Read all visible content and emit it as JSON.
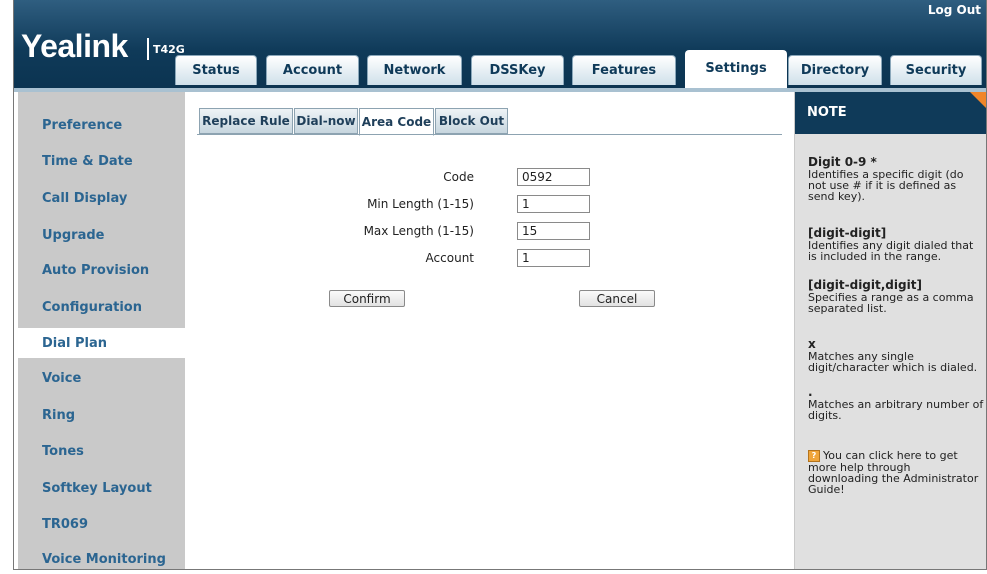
{
  "header": {
    "logout": "Log Out",
    "logo": "Yealink",
    "model": "T42G",
    "tabs": [
      "Status",
      "Account",
      "Network",
      "DSSKey",
      "Features",
      "Settings",
      "Directory",
      "Security"
    ],
    "active_tab": "Settings"
  },
  "sidebar": {
    "items": [
      "Preference",
      "Time & Date",
      "Call Display",
      "Upgrade",
      "Auto Provision",
      "Configuration",
      "Dial Plan",
      "Voice",
      "Ring",
      "Tones",
      "Softkey Layout",
      "TR069",
      "Voice Monitoring"
    ],
    "active": "Dial Plan"
  },
  "main": {
    "subtabs": [
      "Replace Rule",
      "Dial-now",
      "Area Code",
      "Block Out"
    ],
    "active_subtab": "Area Code",
    "fields": [
      {
        "label": "Code",
        "value": "0592"
      },
      {
        "label": "Min Length (1-15)",
        "value": "1"
      },
      {
        "label": "Max Length (1-15)",
        "value": "15"
      },
      {
        "label": "Account",
        "value": "1"
      }
    ],
    "confirm_label": "Confirm",
    "cancel_label": "Cancel"
  },
  "note": {
    "title": "NOTE",
    "blocks": [
      {
        "key": "Digit 0-9 *",
        "text": "Identifies a specific digit (do not use # if it is defined as send key)."
      },
      {
        "key": "[digit-digit]",
        "text": "Identifies any digit dialed that is included in the range."
      },
      {
        "key": "[digit-digit,digit]",
        "text": "Specifies a range as a comma separated list."
      },
      {
        "key": "x",
        "text": "Matches any single digit/character which is dialed."
      },
      {
        "key": ".",
        "text": "Matches an arbitrary number of digits."
      }
    ],
    "help_text": "You can click here to get more help through downloading the Administrator Guide!"
  },
  "colors": {
    "header_dark": "#0f3a59",
    "sidebar_bg": "#c9c9c9",
    "sidebar_text": "#2b6591",
    "note_bg": "#e0e0e0",
    "note_corner": "#f0852a"
  }
}
